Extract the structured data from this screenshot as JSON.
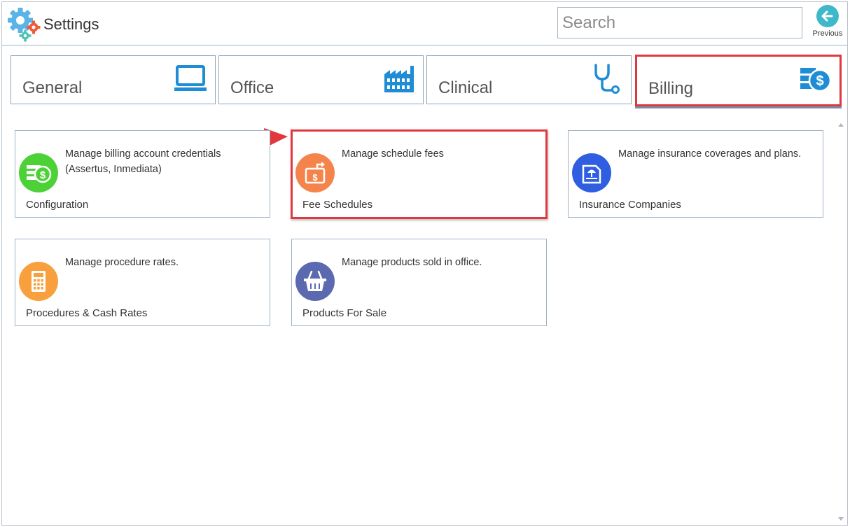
{
  "header": {
    "title": "Settings",
    "logo_icon": "gears-icon",
    "search_placeholder": "Search",
    "previous_label": "Previous"
  },
  "tabs": [
    {
      "label": "General",
      "icon": "monitor-icon",
      "active": false
    },
    {
      "label": "Office",
      "icon": "factory-icon",
      "active": false
    },
    {
      "label": "Clinical",
      "icon": "stethoscope-icon",
      "active": false
    },
    {
      "label": "Billing",
      "icon": "billing-dollar-icon",
      "active": true
    }
  ],
  "cards": [
    {
      "title": "Configuration",
      "description": "Manage billing account credentials (Assertus, Inmediata)",
      "icon": "money-icon",
      "color": "#4cd137"
    },
    {
      "title": "Fee Schedules",
      "description": "Manage schedule fees",
      "icon": "fee-schedule-icon",
      "color": "#f5844c",
      "highlighted": true
    },
    {
      "title": "Insurance Companies",
      "description": "Manage insurance coverages and plans.",
      "icon": "insurance-icon",
      "color": "#2f5fe0"
    },
    {
      "title": "Procedures & Cash Rates",
      "description": "Manage procedure rates.",
      "icon": "calculator-icon",
      "color": "#f8a03d"
    },
    {
      "title": "Products For Sale",
      "description": "Manage products sold in office.",
      "icon": "basket-icon",
      "color": "#5b6ab0"
    }
  ],
  "colors": {
    "accent_blue": "#1f8dd6",
    "highlight_red": "#e0383e",
    "previous_teal": "#3fb8c9"
  }
}
